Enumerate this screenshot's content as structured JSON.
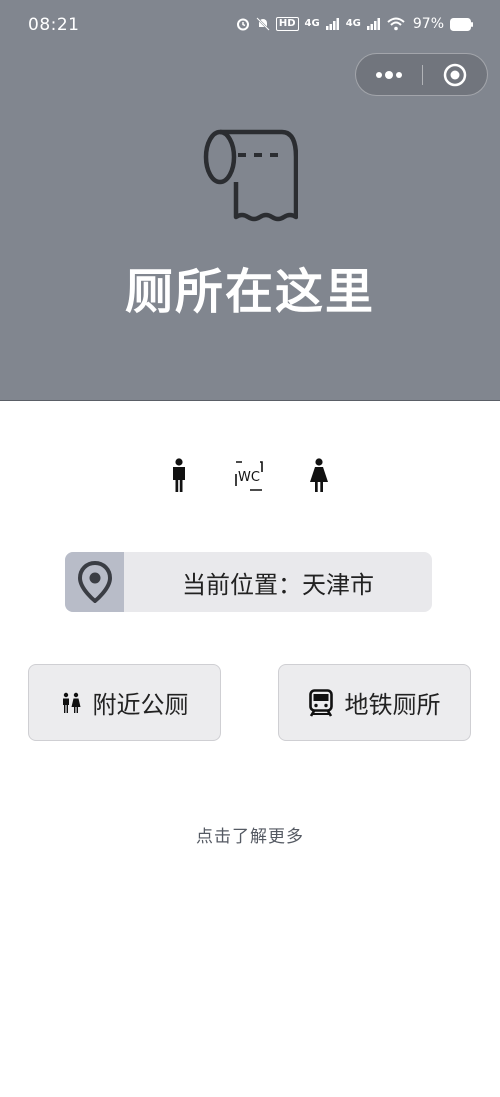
{
  "status_bar": {
    "time": "08:21",
    "net1": "4G",
    "net2": "4G",
    "hd": "HD",
    "battery": "97%"
  },
  "capsule": {
    "more_icon": "more-dots-icon",
    "close_icon": "target-close-icon"
  },
  "hero": {
    "icon": "toilet-paper-icon",
    "title": "厕所在这里"
  },
  "symbols": [
    "man-icon",
    "wc-icon",
    "woman-icon"
  ],
  "symbols_wc_text": "WC",
  "location": {
    "icon": "location-pin-icon",
    "label": "当前位置：天津市"
  },
  "buttons": {
    "nearby": {
      "icon": "restroom-people-icon",
      "label": "附近公厕"
    },
    "subway": {
      "icon": "subway-train-icon",
      "label": "地铁厕所"
    }
  },
  "more_link": "点击了解更多",
  "colors": {
    "header_bg": "#81868f",
    "location_bg": "#e9e9ec",
    "location_icon_bg": "#b8bcc8"
  }
}
